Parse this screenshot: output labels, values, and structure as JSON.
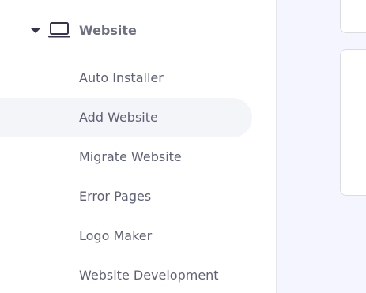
{
  "section": {
    "title": "Website",
    "icon": "laptop-icon",
    "expanded": true
  },
  "nav": {
    "items": [
      {
        "label": "Auto Installer",
        "active": false
      },
      {
        "label": "Add Website",
        "active": true
      },
      {
        "label": "Migrate Website",
        "active": false
      },
      {
        "label": "Error Pages",
        "active": false
      },
      {
        "label": "Logo Maker",
        "active": false
      },
      {
        "label": "Website Development",
        "active": false
      }
    ]
  },
  "colors": {
    "text": "#5e6175",
    "heading": "#6d7081",
    "icon": "#36344d",
    "active_bg": "#f4f5f8",
    "content_bg": "#f4f5ff",
    "border": "#dadce0"
  }
}
